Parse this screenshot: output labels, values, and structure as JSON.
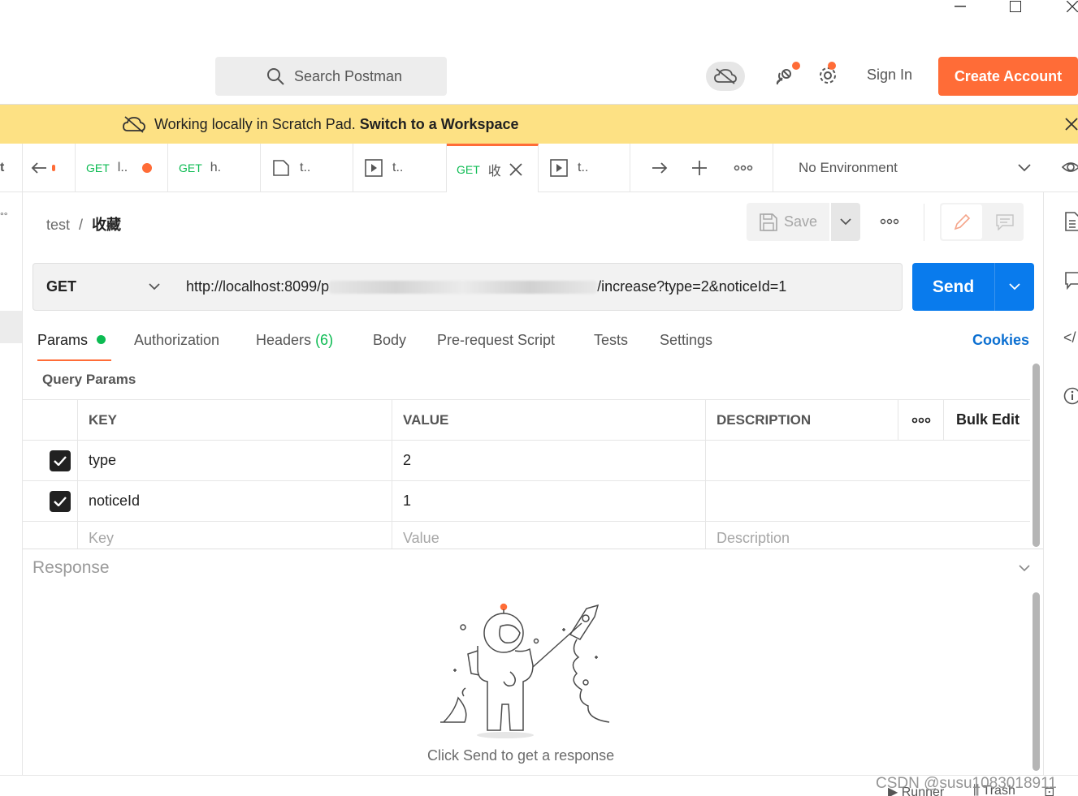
{
  "window": {
    "min_icon": "minimize-icon",
    "max_icon": "maximize-icon",
    "close_icon": "close-icon"
  },
  "header": {
    "search_placeholder": "Search Postman",
    "sign_in": "Sign In",
    "create_account": "Create Account"
  },
  "banner": {
    "text": "Working locally in Scratch Pad.",
    "link": "Switch to a Workspace"
  },
  "tabs": [
    {
      "method": "GET",
      "name": "l.."
    },
    {
      "method": "GET",
      "name": "h."
    },
    {
      "method": "",
      "name": "t.."
    },
    {
      "method": "",
      "name": "t.."
    },
    {
      "method": "GET",
      "name": "收"
    },
    {
      "method": "",
      "name": "t.."
    }
  ],
  "environment": "No Environment",
  "sidebar_left": {
    "top_letter": "t",
    "dots": "°°"
  },
  "breadcrumb": {
    "collection": "test",
    "separator": "/",
    "request": "收藏"
  },
  "toolbar": {
    "save": "Save",
    "more": "ooo"
  },
  "request": {
    "method": "GET",
    "url_start": "http://localhost:8099/p",
    "url_end": "/increase?type=2&noticeId=1",
    "send": "Send"
  },
  "req_tabs": {
    "params": "Params",
    "authorization": "Authorization",
    "headers": "Headers",
    "headers_count": "(6)",
    "body": "Body",
    "prerequest": "Pre-request Script",
    "tests": "Tests",
    "settings": "Settings",
    "cookies": "Cookies"
  },
  "params": {
    "title": "Query Params",
    "columns": {
      "key": "KEY",
      "value": "VALUE",
      "description": "DESCRIPTION",
      "more": "ooo",
      "bulk": "Bulk Edit"
    },
    "rows": [
      {
        "key": "type",
        "value": "2",
        "description": ""
      },
      {
        "key": "noticeId",
        "value": "1",
        "description": ""
      }
    ],
    "placeholders": {
      "key": "Key",
      "value": "Value",
      "description": "Description"
    }
  },
  "response": {
    "title": "Response",
    "hint": "Click Send to get a response"
  },
  "footer": {
    "runner": "Runner",
    "trash": "Trash"
  },
  "watermark": "CSDN @susu1083018911",
  "colors": {
    "accent": "#ff6c37",
    "send": "#097bed",
    "banner": "#fde184",
    "get": "#0cbb52",
    "ok_dot": "#0cbb52"
  }
}
